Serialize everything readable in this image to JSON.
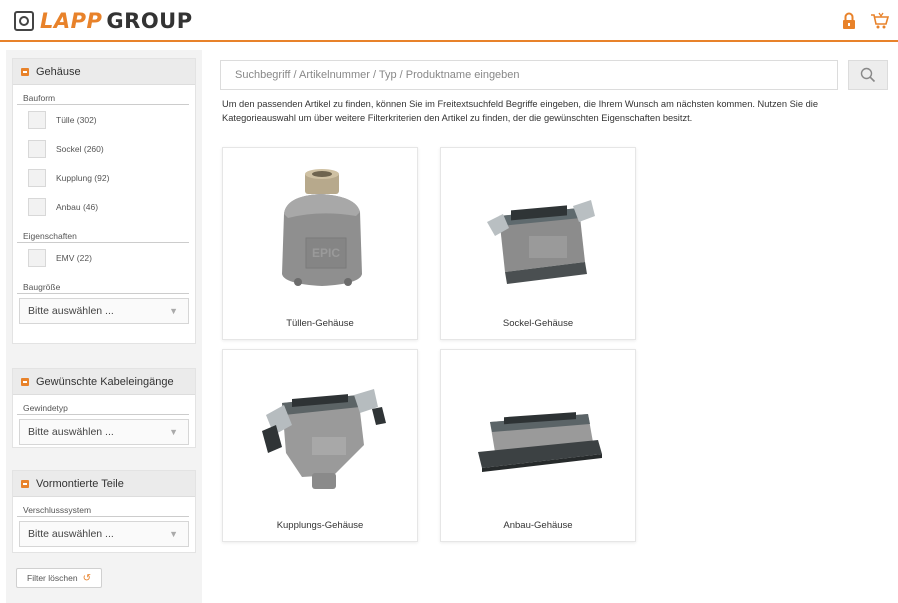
{
  "header": {
    "logo_left": "LAPP",
    "logo_right": "GROUP",
    "icons": [
      "lock-icon",
      "cart-icon"
    ],
    "accent": "#e8822a"
  },
  "sidebar": {
    "panel1": {
      "title": "Gehäuse",
      "bauform_label": "Bauform",
      "options": [
        "Tülle (302)",
        "Sockel (260)",
        "Kupplung (92)",
        "Anbau (46)"
      ],
      "eigenschaften_label": "Eigenschaften",
      "eig_options": [
        "EMV (22)"
      ],
      "baugroesse_label": "Baugröße",
      "select_value": "Bitte auswählen ..."
    },
    "panel2": {
      "title": "Gewünschte Kabeleingänge",
      "sub_label": "Gewindetyp",
      "select_value": "Bitte auswählen ..."
    },
    "panel3": {
      "title": "Vormontierte Teile",
      "sub_label": "Verschlusssystem",
      "select_value": "Bitte auswählen ..."
    },
    "filter_button": "Filter löschen"
  },
  "main": {
    "search_placeholder": "Suchbegriff / Artikelnummer / Typ / Produktname eingeben",
    "intro": "Um den passenden Artikel zu finden, können Sie im Freitextsuchfeld Begriffe eingeben, die Ihrem Wunsch am nächsten kommen. Nutzen Sie die Kategorieauswahl um über weitere Filterkriterien den Artikel zu finden, der die gewünschten Eigenschaften besitzt.",
    "cards": [
      {
        "label": "Tüllen-Gehäuse"
      },
      {
        "label": "Sockel-Gehäuse"
      },
      {
        "label": "Kupplungs-Gehäuse"
      },
      {
        "label": "Anbau-Gehäuse"
      }
    ]
  }
}
